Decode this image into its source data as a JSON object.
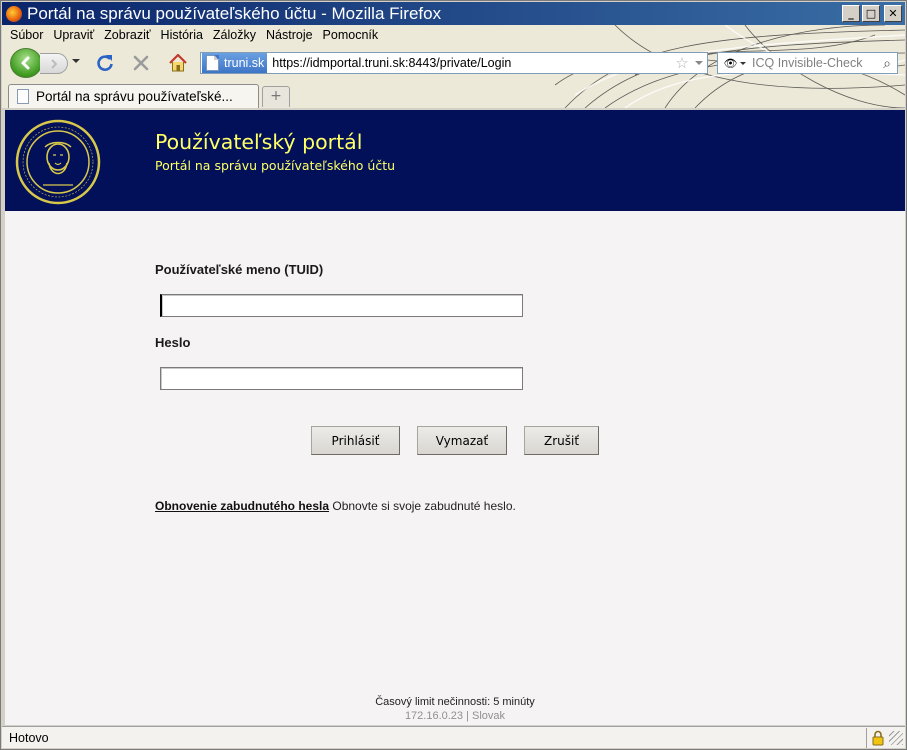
{
  "window": {
    "title": "Portál na správu používateľského účtu - Mozilla Firefox",
    "minimize_label": "_",
    "maximize_label": "□",
    "close_label": "✕"
  },
  "menu": {
    "items": [
      {
        "label": "Súbor",
        "key": "S"
      },
      {
        "label": "Upraviť",
        "key": "U"
      },
      {
        "label": "Zobraziť",
        "key": "Z"
      },
      {
        "label": "História",
        "key": "H"
      },
      {
        "label": "Záložky",
        "key": "l"
      },
      {
        "label": "Nástroje",
        "key": "N"
      },
      {
        "label": "Pomocník",
        "key": "P"
      }
    ]
  },
  "navigation": {
    "site_identity": "truni.sk",
    "url": "https://idmportal.truni.sk:8443/private/Login",
    "search_placeholder": "ICQ Invisible-Check"
  },
  "tabs": [
    {
      "title": "Portál na správu používateľské..."
    }
  ],
  "newtab_label": "+",
  "header": {
    "title": "Používateľský portál",
    "subtitle": "Portál na správu používateľského účtu"
  },
  "form": {
    "username_label": "Používateľské meno (TUID)",
    "username_value": "",
    "password_label": "Heslo",
    "password_value": "",
    "login_button": "Prihlásiť",
    "clear_button": "Vymazať",
    "cancel_button": "Zrušiť"
  },
  "recovery": {
    "link_text": "Obnovenie zabudnutého hesla",
    "description": "Obnovte si svoje zabudnuté heslo."
  },
  "footer": {
    "timeout_text": "Časový limit nečinnosti: 5 minúty",
    "info_text": "172.16.0.23 | Slovak"
  },
  "status": {
    "text": "Hotovo"
  },
  "colors": {
    "header_bg": "#02105a",
    "header_text": "#ffff66",
    "content_bg": "#f6f3f4"
  }
}
